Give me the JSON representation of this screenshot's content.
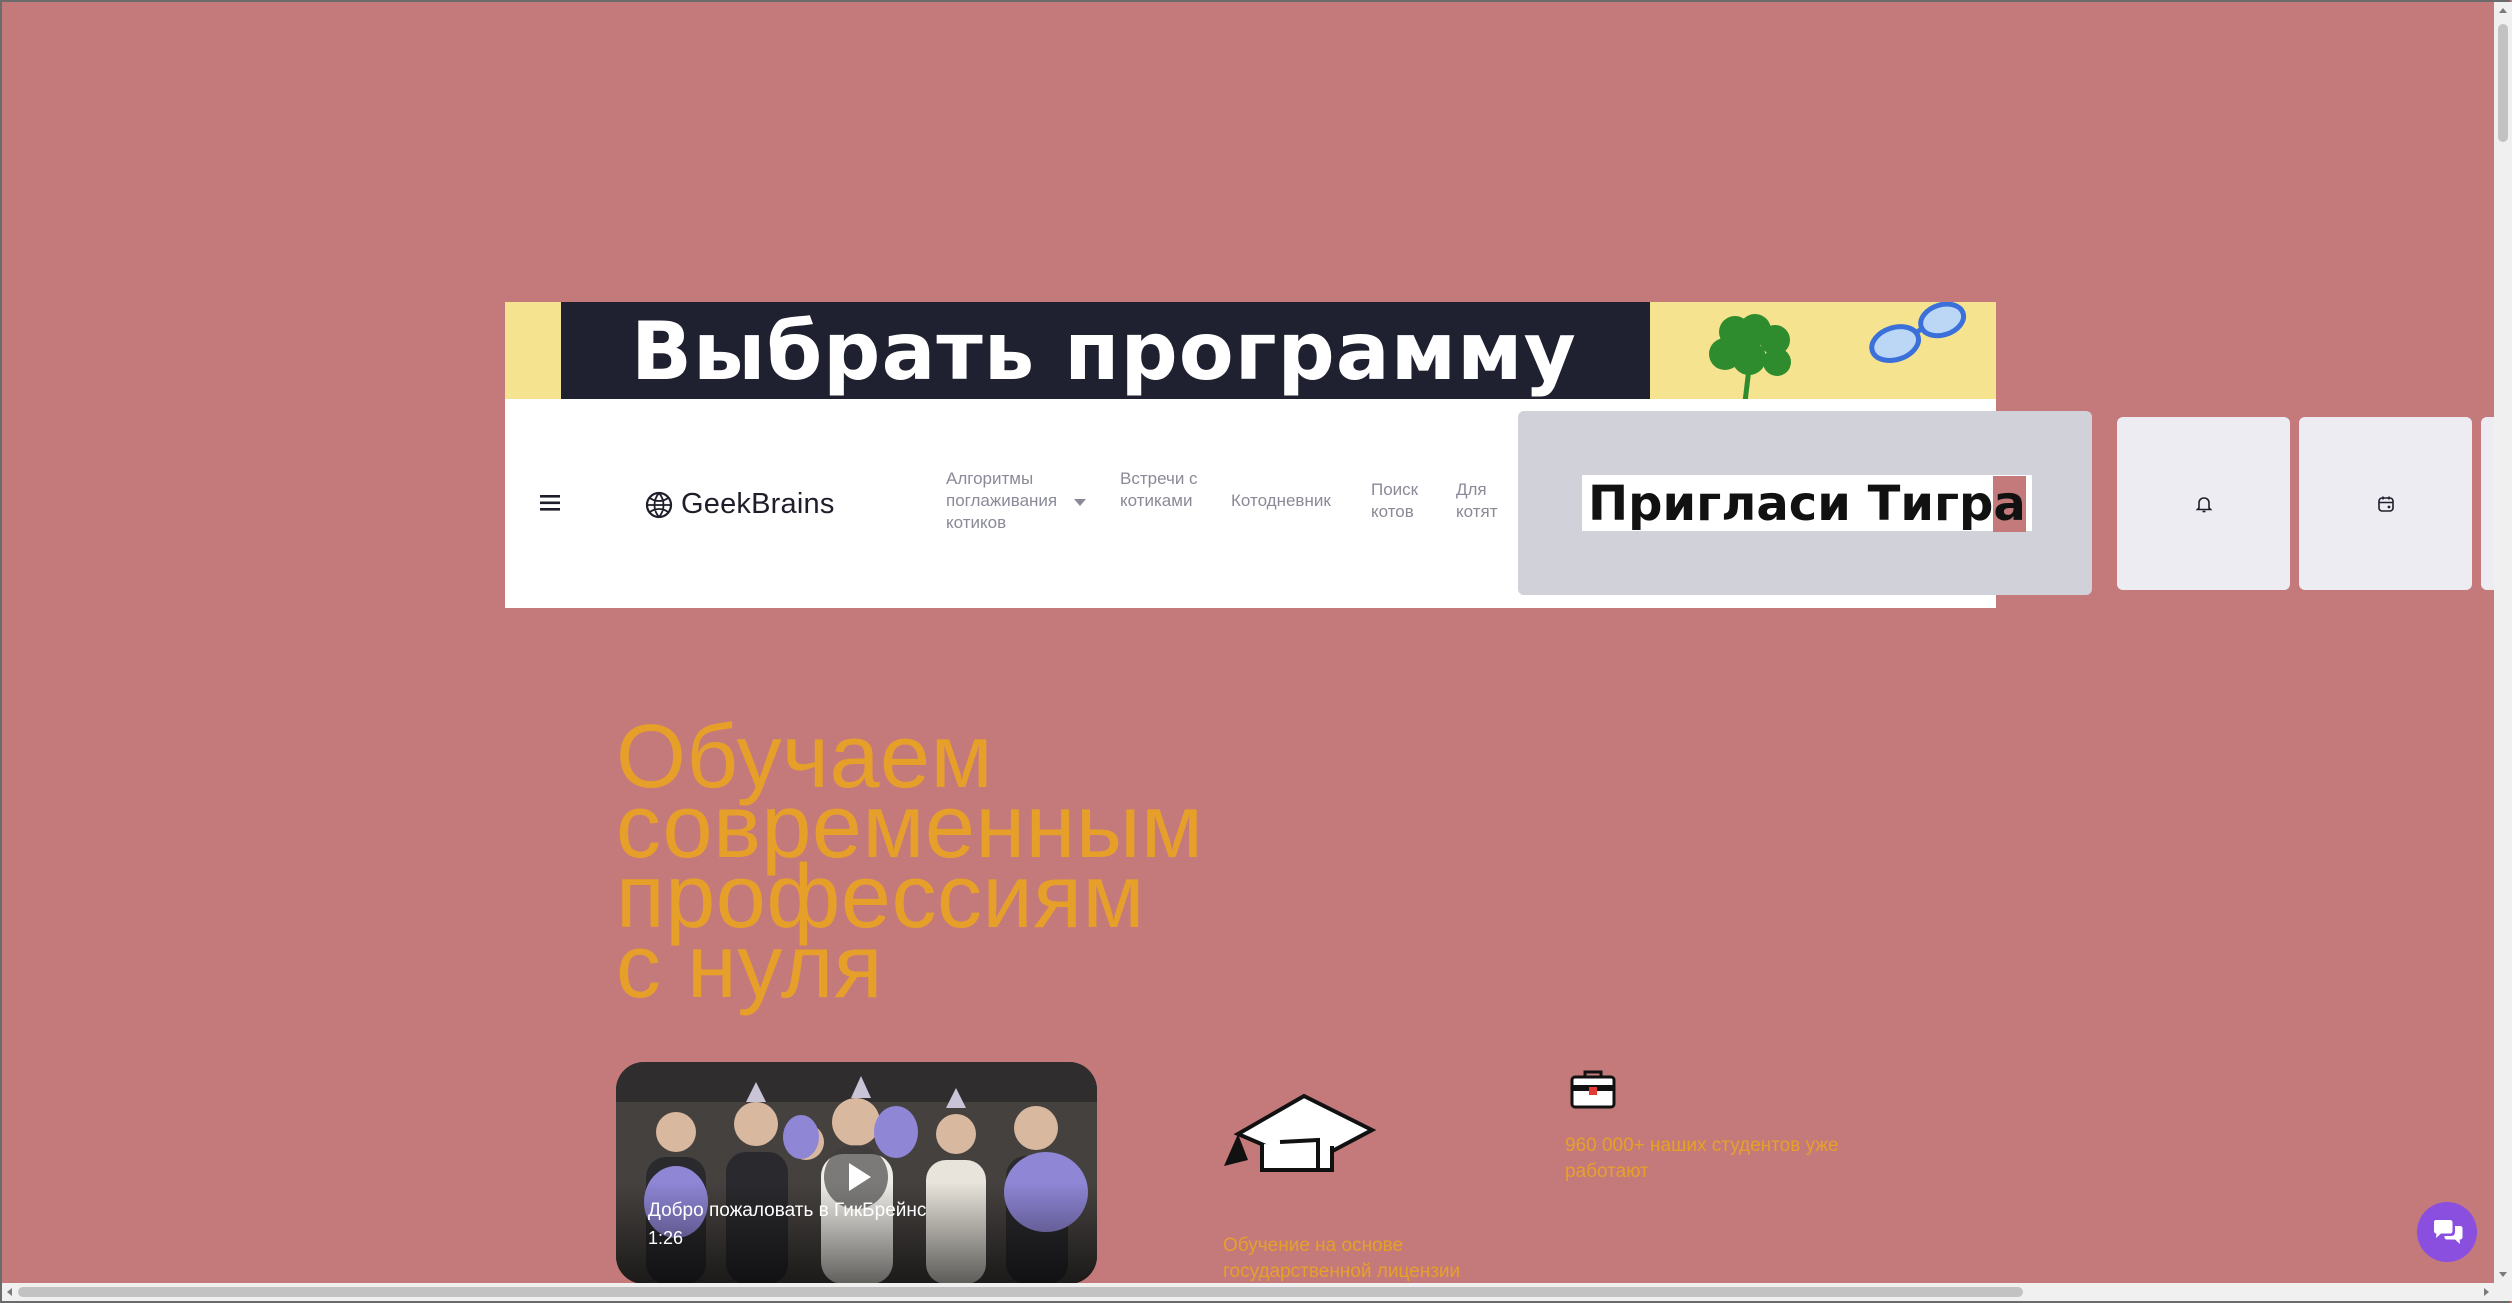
{
  "banner": {
    "text": "Выбрать программу"
  },
  "header": {
    "logo_text": "GeekBrains",
    "nav": [
      {
        "label": "Алгоритмы поглаживания котиков",
        "has_dropdown": true
      },
      {
        "label": "Встречи с котиками"
      },
      {
        "label": "Котодневник"
      },
      {
        "label": "Поиск котов"
      },
      {
        "label": "Для котят"
      }
    ],
    "invite": {
      "text_main": "Пригласи Тигр",
      "text_highlight": "а"
    },
    "icons": [
      "menu-icon",
      "bell-icon",
      "calendar-icon"
    ]
  },
  "hero": {
    "title_lines": [
      "Обучаем",
      "современным",
      "профессиям",
      "с нуля"
    ],
    "video": {
      "title": "Добро пожаловать в ГикБрейнс",
      "duration": "1:26"
    },
    "features": [
      {
        "icon": "graduation-cap-icon",
        "text": "Обучение на основе государственной лицензии"
      },
      {
        "icon": "briefcase-icon",
        "text": "960 000+ наших студентов уже работают"
      }
    ]
  },
  "chat": {
    "icon": "chat-icon"
  },
  "colors": {
    "background": "#c47a7a",
    "accent": "#e6a02a",
    "banner_dark": "#1f2030",
    "banner_yellow": "#f6e38f",
    "chat": "#8b4fe0"
  }
}
